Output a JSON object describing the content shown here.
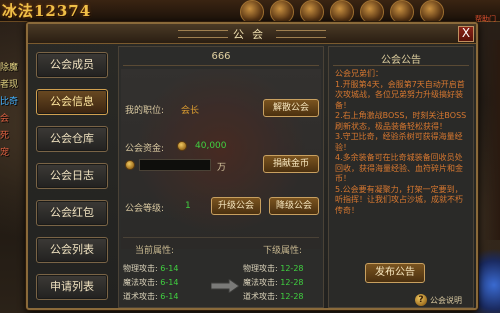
{
  "hud": {
    "level_text": "冰法12374",
    "right_text": "帮助门"
  },
  "left_strip": [
    "除魔",
    "者现",
    "比奇",
    "会",
    "死",
    "宠"
  ],
  "window": {
    "title": "公会",
    "close_label": "X"
  },
  "menu": {
    "items": [
      {
        "label": "公会成员",
        "active": false
      },
      {
        "label": "公会信息",
        "active": true
      },
      {
        "label": "公会仓库",
        "active": false
      },
      {
        "label": "公会日志",
        "active": false
      },
      {
        "label": "公会红包",
        "active": false
      },
      {
        "label": "公会列表",
        "active": false
      },
      {
        "label": "申请列表",
        "active": false
      }
    ]
  },
  "info": {
    "guild_name": "666",
    "position_label": "我的职位:",
    "position_value": "会长",
    "disband_button": "解散公会",
    "funds_label": "公会资金:",
    "funds_value": "40,000",
    "donate_unit": "万",
    "donate_button": "捐献金币",
    "level_label": "公会等级:",
    "level_value": "1",
    "upgrade_button": "升级公会",
    "downgrade_button": "降级公会",
    "current_attr_label": "当前属性:",
    "next_attr_label": "下级属性:",
    "current_attrs": [
      {
        "name": "物理攻击:",
        "value": "6-14"
      },
      {
        "name": "魔法攻击:",
        "value": "6-14"
      },
      {
        "name": "道术攻击:",
        "value": "6-14"
      }
    ],
    "next_attrs": [
      {
        "name": "物理攻击:",
        "value": "12-28"
      },
      {
        "name": "魔法攻击:",
        "value": "12-28"
      },
      {
        "name": "道术攻击:",
        "value": "12-28"
      }
    ]
  },
  "notice": {
    "title": "公会公告",
    "body": "公会兄弟们：\n1.开服第4天，会服第7天自动开启首次攻城战，各位兄弟努力升级搞好装备！\n2.右上角激战BOSS，时刻关注BOSS刷新状态，极品装备轻松获得！\n3.守卫比奇，经验杀树可获得海量经验！\n4.多余装备可在比奇城装备回收员处回收，获得海量经验、血符碎片和金币！\n5.公会要有凝聚力，打架一定要到，听指挥！让我们攻占沙城，成就不朽传奇！",
    "publish_button": "发布公告",
    "help_label": "公会说明",
    "help_icon": "?"
  },
  "colors": {
    "accent_gold": "#c8a060",
    "value_green": "#40d040",
    "notice_text": "#d87830"
  }
}
